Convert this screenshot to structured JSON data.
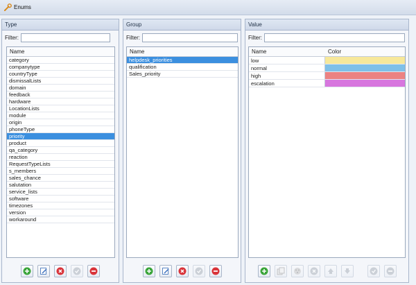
{
  "window": {
    "title": "Enums"
  },
  "type_panel": {
    "header": "Type",
    "filter_label": "Filter:",
    "filter_value": "",
    "column": "Name",
    "items": [
      "category",
      "companytype",
      "countryType",
      "dismissalLists",
      "domain",
      "feedback",
      "hardware",
      "LocationLists",
      "module",
      "origin",
      "phoneType",
      "priority",
      "product",
      "qa_category",
      "reaction",
      "RequestTypeLists",
      "s_members",
      "sales_chance",
      "salutation",
      "service_lists",
      "software",
      "timezones",
      "version",
      "workaround"
    ],
    "selected_index": 11
  },
  "group_panel": {
    "header": "Group",
    "filter_label": "Filter:",
    "filter_value": "",
    "column": "Name",
    "items": [
      "helpdesk_priorities",
      "qualification",
      "Sales_priority"
    ],
    "selected_index": 0
  },
  "value_panel": {
    "header": "Value",
    "filter_label": "Filter:",
    "filter_value": "",
    "columns": [
      "Name",
      "Color"
    ],
    "rows": [
      {
        "name": "low",
        "color": "#f7e89a"
      },
      {
        "name": "normal",
        "color": "#7fc0e8"
      },
      {
        "name": "high",
        "color": "#ec8282"
      },
      {
        "name": "escalation",
        "color": "#d776de"
      }
    ]
  },
  "icons": {
    "add": "add-icon",
    "edit": "edit-icon",
    "delete": "delete-icon",
    "confirm": "confirm-icon",
    "remove": "remove-icon",
    "copy": "copy-icon",
    "palette": "palette-icon",
    "up": "arrow-up-icon",
    "down": "arrow-down-icon"
  }
}
